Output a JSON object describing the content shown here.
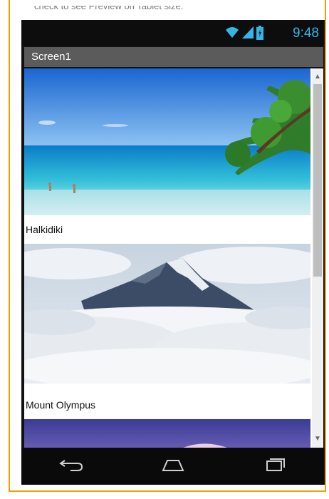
{
  "hint": {
    "text": "check to see Preview on Tablet size."
  },
  "status_bar": {
    "time": "9:48",
    "icons": [
      "wifi-icon",
      "signal-icon",
      "battery-icon"
    ]
  },
  "screen": {
    "title": "Screen1"
  },
  "gallery": {
    "items": [
      {
        "image": "beach-photo",
        "caption": "Halkidiki"
      },
      {
        "image": "mountain-photo",
        "caption": "Mount Olympus"
      },
      {
        "image": "purple-sky-photo",
        "caption": ""
      }
    ]
  },
  "navigation": {
    "icons": [
      "back-icon",
      "home-icon",
      "recent-apps-icon"
    ]
  },
  "colors": {
    "accent": "#33b5e5",
    "frame": "#f0a100",
    "title_bar": "#5b5b5b"
  }
}
